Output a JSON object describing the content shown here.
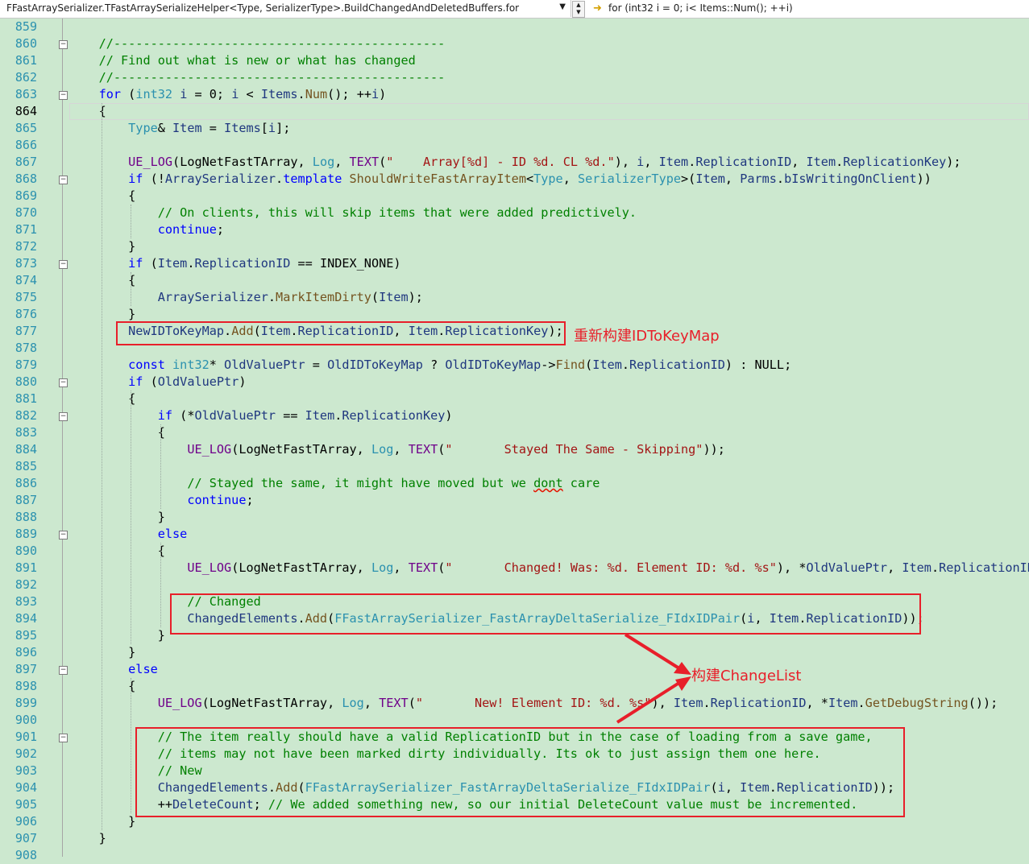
{
  "navbar": {
    "scope": "FFastArraySerializer.TFastArraySerializeHelper<Type, SerializerType>.BuildChangedAndDeletedBuffers.for",
    "member": "for (int32 i = 0; i< Items::Num(); ++i)",
    "member_icon": "arrow-right-icon",
    "dropdown_icon": "chevron-down-icon"
  },
  "current_line": 864,
  "annotations": {
    "rebuild_map": "重新构建IDToKeyMap",
    "build_change_list": "构建ChangeList"
  },
  "colors": {
    "background": "#cce8cf",
    "line_number": "#2b91af",
    "keyword": "#0000ff",
    "type": "#2b91af",
    "comment": "#008000",
    "string": "#a31515",
    "macro": "#6f008a",
    "function": "#74531f",
    "annotation": "#e81f2a"
  },
  "lines": [
    {
      "n": 859,
      "fold": false,
      "t": []
    },
    {
      "n": 860,
      "fold": true,
      "t": [
        [
          "    ",
          "pl"
        ],
        [
          "//---------------------------------------------",
          "cm"
        ]
      ]
    },
    {
      "n": 861,
      "fold": false,
      "t": [
        [
          "    ",
          "pl"
        ],
        [
          "// Find out what is new or what has changed",
          "cm"
        ]
      ]
    },
    {
      "n": 862,
      "fold": false,
      "t": [
        [
          "    ",
          "pl"
        ],
        [
          "//---------------------------------------------",
          "cm"
        ]
      ]
    },
    {
      "n": 863,
      "fold": true,
      "t": [
        [
          "    ",
          "pl"
        ],
        [
          "for",
          "kw"
        ],
        [
          " (",
          "pl"
        ],
        [
          "int32",
          "ty"
        ],
        [
          " ",
          "pl"
        ],
        [
          "i",
          "vr"
        ],
        [
          " = 0; ",
          "pl"
        ],
        [
          "i",
          "vr"
        ],
        [
          " < ",
          "pl"
        ],
        [
          "Items",
          "vr"
        ],
        [
          ".",
          "pl"
        ],
        [
          "Num",
          "fn"
        ],
        [
          "(); ++",
          "pl"
        ],
        [
          "i",
          "vr"
        ],
        [
          ")",
          "pl"
        ]
      ]
    },
    {
      "n": 864,
      "fold": false,
      "t": [
        [
          "    {",
          "pl"
        ]
      ]
    },
    {
      "n": 865,
      "fold": false,
      "t": [
        [
          "        ",
          "pl"
        ],
        [
          "Type",
          "ty"
        ],
        [
          "& ",
          "pl"
        ],
        [
          "Item",
          "vr"
        ],
        [
          " = ",
          "pl"
        ],
        [
          "Items",
          "vr"
        ],
        [
          "[",
          "pl"
        ],
        [
          "i",
          "vr"
        ],
        [
          "];",
          "pl"
        ]
      ]
    },
    {
      "n": 866,
      "fold": false,
      "t": []
    },
    {
      "n": 867,
      "fold": false,
      "t": [
        [
          "        ",
          "pl"
        ],
        [
          "UE_LOG",
          "mc"
        ],
        [
          "(",
          "pl"
        ],
        [
          "LogNetFastTArray",
          "pl"
        ],
        [
          ", ",
          "pl"
        ],
        [
          "Log",
          "ty"
        ],
        [
          ", ",
          "pl"
        ],
        [
          "TEXT",
          "mc"
        ],
        [
          "(",
          "pl"
        ],
        [
          "\"    Array[%d] - ID %d. CL %d.\"",
          "st"
        ],
        [
          "), ",
          "pl"
        ],
        [
          "i",
          "vr"
        ],
        [
          ", ",
          "pl"
        ],
        [
          "Item",
          "vr"
        ],
        [
          ".",
          "pl"
        ],
        [
          "ReplicationID",
          "vr"
        ],
        [
          ", ",
          "pl"
        ],
        [
          "Item",
          "vr"
        ],
        [
          ".",
          "pl"
        ],
        [
          "ReplicationKey",
          "vr"
        ],
        [
          ");",
          "pl"
        ]
      ]
    },
    {
      "n": 868,
      "fold": true,
      "t": [
        [
          "        ",
          "pl"
        ],
        [
          "if",
          "kw"
        ],
        [
          " (!",
          "pl"
        ],
        [
          "ArraySerializer",
          "vr"
        ],
        [
          ".",
          "pl"
        ],
        [
          "template",
          "kw"
        ],
        [
          " ",
          "pl"
        ],
        [
          "ShouldWriteFastArrayItem",
          "fn"
        ],
        [
          "<",
          "pl"
        ],
        [
          "Type",
          "ty"
        ],
        [
          ", ",
          "pl"
        ],
        [
          "SerializerType",
          "ty"
        ],
        [
          ">(",
          "pl"
        ],
        [
          "Item",
          "vr"
        ],
        [
          ", ",
          "pl"
        ],
        [
          "Parms",
          "vr"
        ],
        [
          ".",
          "pl"
        ],
        [
          "bIsWritingOnClient",
          "vr"
        ],
        [
          "))",
          "pl"
        ]
      ]
    },
    {
      "n": 869,
      "fold": false,
      "t": [
        [
          "        {",
          "pl"
        ]
      ]
    },
    {
      "n": 870,
      "fold": false,
      "t": [
        [
          "            ",
          "pl"
        ],
        [
          "// On clients, this will skip items that were added predictively.",
          "cm"
        ]
      ]
    },
    {
      "n": 871,
      "fold": false,
      "t": [
        [
          "            ",
          "pl"
        ],
        [
          "continue",
          "kw"
        ],
        [
          ";",
          "pl"
        ]
      ]
    },
    {
      "n": 872,
      "fold": false,
      "t": [
        [
          "        }",
          "pl"
        ]
      ]
    },
    {
      "n": 873,
      "fold": true,
      "t": [
        [
          "        ",
          "pl"
        ],
        [
          "if",
          "kw"
        ],
        [
          " (",
          "pl"
        ],
        [
          "Item",
          "vr"
        ],
        [
          ".",
          "pl"
        ],
        [
          "ReplicationID",
          "vr"
        ],
        [
          " == ",
          "pl"
        ],
        [
          "INDEX_NONE",
          "pl"
        ],
        [
          ")",
          "pl"
        ]
      ]
    },
    {
      "n": 874,
      "fold": false,
      "t": [
        [
          "        {",
          "pl"
        ]
      ]
    },
    {
      "n": 875,
      "fold": false,
      "t": [
        [
          "            ",
          "pl"
        ],
        [
          "ArraySerializer",
          "vr"
        ],
        [
          ".",
          "pl"
        ],
        [
          "MarkItemDirty",
          "fn"
        ],
        [
          "(",
          "pl"
        ],
        [
          "Item",
          "vr"
        ],
        [
          ");",
          "pl"
        ]
      ]
    },
    {
      "n": 876,
      "fold": false,
      "t": [
        [
          "        }",
          "pl"
        ]
      ]
    },
    {
      "n": 877,
      "fold": false,
      "t": [
        [
          "        ",
          "pl"
        ],
        [
          "NewIDToKeyMap",
          "vr"
        ],
        [
          ".",
          "pl"
        ],
        [
          "Add",
          "fn"
        ],
        [
          "(",
          "pl"
        ],
        [
          "Item",
          "vr"
        ],
        [
          ".",
          "pl"
        ],
        [
          "ReplicationID",
          "vr"
        ],
        [
          ", ",
          "pl"
        ],
        [
          "Item",
          "vr"
        ],
        [
          ".",
          "pl"
        ],
        [
          "ReplicationKey",
          "vr"
        ],
        [
          ");",
          "pl"
        ]
      ]
    },
    {
      "n": 878,
      "fold": false,
      "t": []
    },
    {
      "n": 879,
      "fold": false,
      "t": [
        [
          "        ",
          "pl"
        ],
        [
          "const",
          "kw"
        ],
        [
          " ",
          "pl"
        ],
        [
          "int32",
          "ty"
        ],
        [
          "* ",
          "pl"
        ],
        [
          "OldValuePtr",
          "vr"
        ],
        [
          " = ",
          "pl"
        ],
        [
          "OldIDToKeyMap",
          "vr"
        ],
        [
          " ? ",
          "pl"
        ],
        [
          "OldIDToKeyMap",
          "vr"
        ],
        [
          "->",
          "pl"
        ],
        [
          "Find",
          "fn"
        ],
        [
          "(",
          "pl"
        ],
        [
          "Item",
          "vr"
        ],
        [
          ".",
          "pl"
        ],
        [
          "ReplicationID",
          "vr"
        ],
        [
          ") : ",
          "pl"
        ],
        [
          "NULL",
          "pl"
        ],
        [
          ";",
          "pl"
        ]
      ]
    },
    {
      "n": 880,
      "fold": true,
      "t": [
        [
          "        ",
          "pl"
        ],
        [
          "if",
          "kw"
        ],
        [
          " (",
          "pl"
        ],
        [
          "OldValuePtr",
          "vr"
        ],
        [
          ")",
          "pl"
        ]
      ]
    },
    {
      "n": 881,
      "fold": false,
      "t": [
        [
          "        {",
          "pl"
        ]
      ]
    },
    {
      "n": 882,
      "fold": true,
      "t": [
        [
          "            ",
          "pl"
        ],
        [
          "if",
          "kw"
        ],
        [
          " (*",
          "pl"
        ],
        [
          "OldValuePtr",
          "vr"
        ],
        [
          " == ",
          "pl"
        ],
        [
          "Item",
          "vr"
        ],
        [
          ".",
          "pl"
        ],
        [
          "ReplicationKey",
          "vr"
        ],
        [
          ")",
          "pl"
        ]
      ]
    },
    {
      "n": 883,
      "fold": false,
      "t": [
        [
          "            {",
          "pl"
        ]
      ]
    },
    {
      "n": 884,
      "fold": false,
      "t": [
        [
          "                ",
          "pl"
        ],
        [
          "UE_LOG",
          "mc"
        ],
        [
          "(",
          "pl"
        ],
        [
          "LogNetFastTArray",
          "pl"
        ],
        [
          ", ",
          "pl"
        ],
        [
          "Log",
          "ty"
        ],
        [
          ", ",
          "pl"
        ],
        [
          "TEXT",
          "mc"
        ],
        [
          "(",
          "pl"
        ],
        [
          "\"       Stayed The Same - Skipping\"",
          "st"
        ],
        [
          "));",
          "pl"
        ]
      ]
    },
    {
      "n": 885,
      "fold": false,
      "t": []
    },
    {
      "n": 886,
      "fold": false,
      "t": [
        [
          "                ",
          "pl"
        ],
        [
          "// Stayed the same, it might have moved but we ",
          "cm"
        ],
        [
          "dont",
          "cm sq"
        ],
        [
          " care",
          "cm"
        ]
      ]
    },
    {
      "n": 887,
      "fold": false,
      "t": [
        [
          "                ",
          "pl"
        ],
        [
          "continue",
          "kw"
        ],
        [
          ";",
          "pl"
        ]
      ]
    },
    {
      "n": 888,
      "fold": false,
      "t": [
        [
          "            }",
          "pl"
        ]
      ]
    },
    {
      "n": 889,
      "fold": true,
      "t": [
        [
          "            ",
          "pl"
        ],
        [
          "else",
          "kw"
        ]
      ]
    },
    {
      "n": 890,
      "fold": false,
      "t": [
        [
          "            {",
          "pl"
        ]
      ]
    },
    {
      "n": 891,
      "fold": false,
      "t": [
        [
          "                ",
          "pl"
        ],
        [
          "UE_LOG",
          "mc"
        ],
        [
          "(",
          "pl"
        ],
        [
          "LogNetFastTArray",
          "pl"
        ],
        [
          ", ",
          "pl"
        ],
        [
          "Log",
          "ty"
        ],
        [
          ", ",
          "pl"
        ],
        [
          "TEXT",
          "mc"
        ],
        [
          "(",
          "pl"
        ],
        [
          "\"       Changed! Was: %d. Element ID: %d. %s\"",
          "st"
        ],
        [
          "), *",
          "pl"
        ],
        [
          "OldValuePtr",
          "vr"
        ],
        [
          ", ",
          "pl"
        ],
        [
          "Item",
          "vr"
        ],
        [
          ".",
          "pl"
        ],
        [
          "ReplicationID",
          "vr"
        ],
        [
          ",",
          "pl"
        ]
      ]
    },
    {
      "n": 892,
      "fold": false,
      "t": []
    },
    {
      "n": 893,
      "fold": false,
      "t": [
        [
          "                ",
          "pl"
        ],
        [
          "// Changed",
          "cm"
        ]
      ]
    },
    {
      "n": 894,
      "fold": false,
      "t": [
        [
          "                ",
          "pl"
        ],
        [
          "ChangedElements",
          "vr"
        ],
        [
          ".",
          "pl"
        ],
        [
          "Add",
          "fn"
        ],
        [
          "(",
          "pl"
        ],
        [
          "FFastArraySerializer_FastArrayDeltaSerialize_FIdxIDPair",
          "ty"
        ],
        [
          "(",
          "pl"
        ],
        [
          "i",
          "vr"
        ],
        [
          ", ",
          "pl"
        ],
        [
          "Item",
          "vr"
        ],
        [
          ".",
          "pl"
        ],
        [
          "ReplicationID",
          "vr"
        ],
        [
          "));",
          "pl"
        ]
      ]
    },
    {
      "n": 895,
      "fold": false,
      "t": [
        [
          "            }",
          "pl"
        ]
      ]
    },
    {
      "n": 896,
      "fold": false,
      "t": [
        [
          "        }",
          "pl"
        ]
      ]
    },
    {
      "n": 897,
      "fold": true,
      "t": [
        [
          "        ",
          "pl"
        ],
        [
          "else",
          "kw"
        ]
      ]
    },
    {
      "n": 898,
      "fold": false,
      "t": [
        [
          "        {",
          "pl"
        ]
      ]
    },
    {
      "n": 899,
      "fold": false,
      "t": [
        [
          "            ",
          "pl"
        ],
        [
          "UE_LOG",
          "mc"
        ],
        [
          "(",
          "pl"
        ],
        [
          "LogNetFastTArray",
          "pl"
        ],
        [
          ", ",
          "pl"
        ],
        [
          "Log",
          "ty"
        ],
        [
          ", ",
          "pl"
        ],
        [
          "TEXT",
          "mc"
        ],
        [
          "(",
          "pl"
        ],
        [
          "\"       New! Element ID: %d. %s\"",
          "st"
        ],
        [
          "), ",
          "pl"
        ],
        [
          "Item",
          "vr"
        ],
        [
          ".",
          "pl"
        ],
        [
          "ReplicationID",
          "vr"
        ],
        [
          ", *",
          "pl"
        ],
        [
          "Item",
          "vr"
        ],
        [
          ".",
          "pl"
        ],
        [
          "GetDebugString",
          "fn"
        ],
        [
          "());",
          "pl"
        ]
      ]
    },
    {
      "n": 900,
      "fold": false,
      "t": []
    },
    {
      "n": 901,
      "fold": true,
      "t": [
        [
          "            ",
          "pl"
        ],
        [
          "// The item really should have a valid ReplicationID but in the case of loading from a save game,",
          "cm"
        ]
      ]
    },
    {
      "n": 902,
      "fold": false,
      "t": [
        [
          "            ",
          "pl"
        ],
        [
          "// items may not have been marked dirty individually. Its ok to just assign them one here.",
          "cm"
        ]
      ]
    },
    {
      "n": 903,
      "fold": false,
      "t": [
        [
          "            ",
          "pl"
        ],
        [
          "// New",
          "cm"
        ]
      ]
    },
    {
      "n": 904,
      "fold": false,
      "t": [
        [
          "            ",
          "pl"
        ],
        [
          "ChangedElements",
          "vr"
        ],
        [
          ".",
          "pl"
        ],
        [
          "Add",
          "fn"
        ],
        [
          "(",
          "pl"
        ],
        [
          "FFastArraySerializer_FastArrayDeltaSerialize_FIdxIDPair",
          "ty"
        ],
        [
          "(",
          "pl"
        ],
        [
          "i",
          "vr"
        ],
        [
          ", ",
          "pl"
        ],
        [
          "Item",
          "vr"
        ],
        [
          ".",
          "pl"
        ],
        [
          "ReplicationID",
          "vr"
        ],
        [
          "));",
          "pl"
        ]
      ]
    },
    {
      "n": 905,
      "fold": false,
      "t": [
        [
          "            ++",
          "pl"
        ],
        [
          "DeleteCount",
          "vr"
        ],
        [
          "; ",
          "pl"
        ],
        [
          "// We added something new, so our initial DeleteCount value must be incremented.",
          "cm"
        ]
      ]
    },
    {
      "n": 906,
      "fold": false,
      "t": [
        [
          "        }",
          "pl"
        ]
      ]
    },
    {
      "n": 907,
      "fold": false,
      "t": [
        [
          "    }",
          "pl"
        ]
      ]
    },
    {
      "n": 908,
      "fold": false,
      "t": []
    }
  ]
}
